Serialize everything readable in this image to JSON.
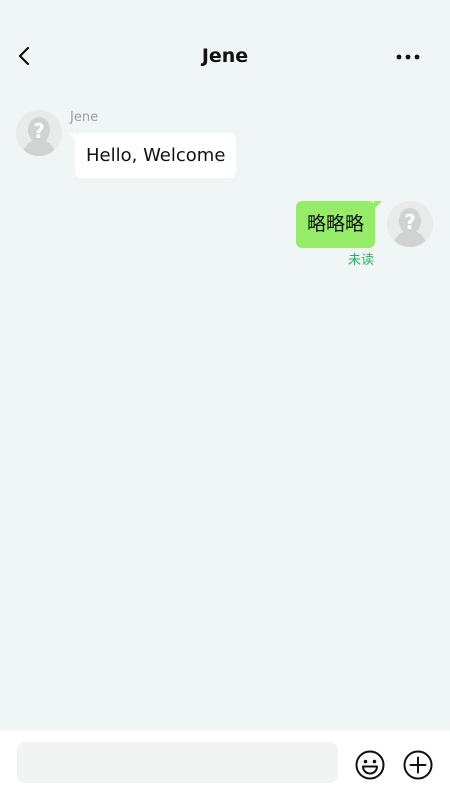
{
  "header": {
    "title": "Jene",
    "back_icon": "chevron-left-icon",
    "more_icon": "more-horizontal-icon"
  },
  "messages": [
    {
      "direction": "incoming",
      "sender": "Jene",
      "text": "Hello, Welcome",
      "avatar_icon": "unknown-user-avatar-icon"
    },
    {
      "direction": "outgoing",
      "text": "略略略",
      "status": "未读",
      "avatar_icon": "unknown-user-avatar-icon"
    }
  ],
  "composer": {
    "placeholder": "",
    "value": "",
    "emoji_icon": "emoji-icon",
    "plus_icon": "plus-circle-icon"
  },
  "colors": {
    "background": "#EFF6F5",
    "incoming_bubble": "#FFFFFF",
    "outgoing_bubble": "#95EC69",
    "status_text": "#2BAE66",
    "sender_name": "#9AA0A3"
  }
}
